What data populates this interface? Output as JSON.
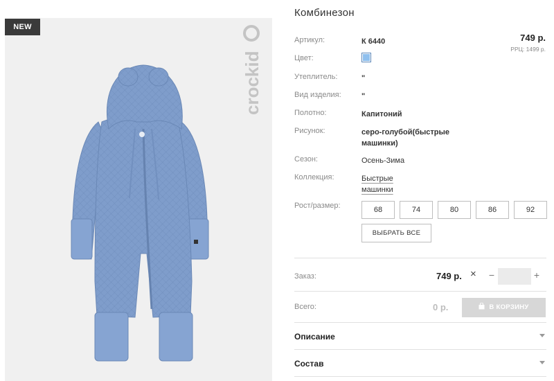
{
  "product": {
    "badge": "NEW",
    "brand": "crockid",
    "title": "Комбинезон"
  },
  "price": {
    "current": "749 р.",
    "rrp": "РРЦ: 1499 р."
  },
  "attributes": [
    {
      "label": "Артикул:",
      "value": "К 6440"
    },
    {
      "label": "Цвет:",
      "value": "",
      "swatch_color": "#8fc0ee"
    },
    {
      "label": "Утеплитель:",
      "value": "\""
    },
    {
      "label": "Вид изделия:",
      "value": "\""
    },
    {
      "label": "Полотно:",
      "value": "Капитоний"
    },
    {
      "label": "Рисунок:",
      "value": "серо-голубой(быстрые машинки)"
    },
    {
      "label": "Сезон:",
      "value": "Осень-Зима"
    },
    {
      "label": "Коллекция:",
      "value": "Быстрые машинки"
    }
  ],
  "sizes": {
    "label": "Рост/размер:",
    "options": [
      "68",
      "74",
      "80",
      "86",
      "92"
    ],
    "select_all": "ВЫБРАТЬ ВСЕ"
  },
  "order": {
    "label": "Заказ:",
    "price": "749 р.",
    "quantity_value": "",
    "minus": "−",
    "plus": "+",
    "times": "×"
  },
  "total": {
    "label": "Всего:",
    "value": "0 р.",
    "cart_button": "В КОРЗИНУ"
  },
  "sections": [
    {
      "label": "Описание"
    },
    {
      "label": "Состав"
    }
  ],
  "colors": {
    "badge_bg": "#3a3a3a",
    "swatch": "#8fc0ee",
    "cart_button_bg": "#d7d7d7",
    "garment": "#7d9bc9"
  }
}
